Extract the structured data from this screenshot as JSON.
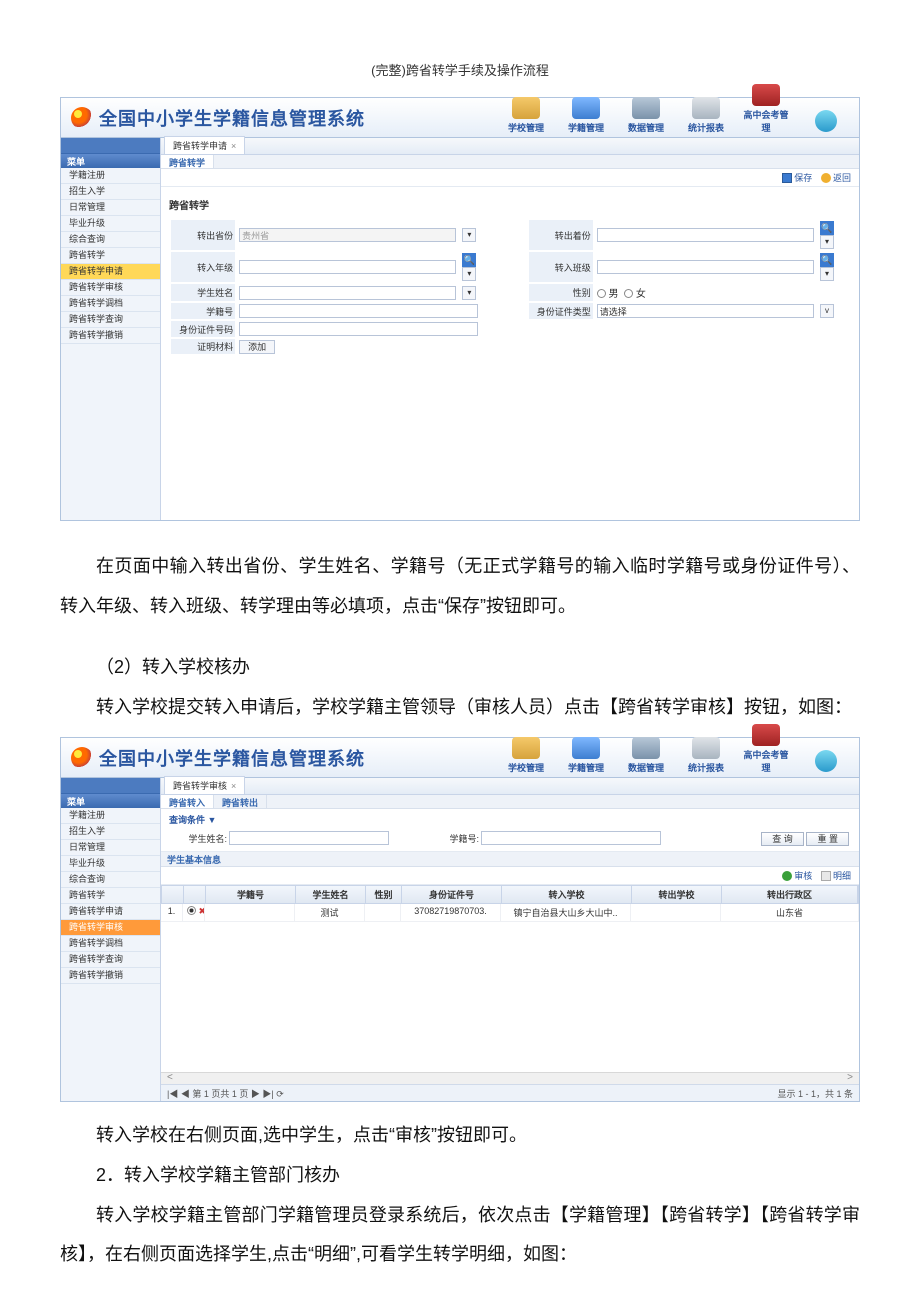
{
  "page_title": "(完整)跨省转学手续及操作流程",
  "system_title": "全国中小学生学籍信息管理系统",
  "topnav": [
    "学校管理",
    "学籍管理",
    "数据管理",
    "统计报表",
    "高中会考管理"
  ],
  "sidebar1": {
    "menu_header": "菜单",
    "items": [
      "学籍注册",
      "招生入学",
      "日常管理",
      "毕业升级",
      "综合查询",
      "跨省转学",
      "跨省转学申请",
      "跨省转学审核",
      "跨省转学调档",
      "跨省转学查询",
      "跨省转学撤销"
    ],
    "selected": "跨省转学申请"
  },
  "screen1": {
    "tab": "跨省转学申请",
    "sub": "跨省转学",
    "toolbar": {
      "save": "保存",
      "back": "返回"
    },
    "section_title": "跨省转学",
    "fields": {
      "out_prov_label": "转出省份",
      "out_prov_value": "贵州省",
      "out_county_label": "转出着份",
      "in_grade_label": "转入年级",
      "in_class_label": "转入班级",
      "name_label": "学生姓名",
      "gender_label": "性别",
      "gender_m": "男",
      "gender_f": "女",
      "sid_label": "学籍号",
      "idtype_label": "身份证件类型",
      "idtype_value": "请选择",
      "idno_label": "身份证件号码",
      "proof_label": "证明材料",
      "add_btn": "添加"
    }
  },
  "para1": "在页面中输入转出省份、学生姓名、学籍号（无正式学籍号的输入临时学籍号或身份证件号）、转入年级、转入班级、转学理由等必填项，点击“保存”按钮即可。",
  "para2": "（2）转入学校核办",
  "para3": "转入学校提交转入申请后，学校学籍主管领导（审核人员）点击【跨省转学审核】按钮，如图：",
  "sidebar2": {
    "menu_header": "菜单",
    "items": [
      "学籍注册",
      "招生入学",
      "日常管理",
      "毕业升级",
      "综合查询",
      "跨省转学",
      "跨省转学申请",
      "跨省转学审核",
      "跨省转学调档",
      "跨省转学查询",
      "跨省转学撤销"
    ],
    "selected": "跨省转学审核"
  },
  "screen2": {
    "tab": "跨省转学审核",
    "sub_in": "跨省转入",
    "sub_out": "跨省转出",
    "filter": {
      "cond": "查询条件 ▼",
      "name_label": "学生姓名:",
      "sid_label": "学籍号:",
      "q": "查 询",
      "r": "重 置"
    },
    "sec_title": "学生基本信息",
    "toolbar": {
      "ok": "审核",
      "det": "明细"
    },
    "headers": [
      "",
      "",
      "学籍号",
      "学生姓名",
      "性别",
      "身份证件号",
      "转入学校",
      "转出学校",
      "转出行政区"
    ],
    "row": {
      "idx": "1.",
      "mark": "✖",
      "sid": "",
      "name": "测试",
      "sex": "",
      "idno": "37082719870703.",
      "in_school": "镇宁自治县大山乡大山中..",
      "out_school": "",
      "out_area": "山东省"
    },
    "pager": {
      "left": "|◀  ◀  第 1   页共 1 页  ▶  ▶|  ⟳",
      "right": "显示 1 - 1，共 1 条"
    }
  },
  "para4": "转入学校在右侧页面,选中学生，点击“审核”按钮即可。",
  "para5": "2．转入学校学籍主管部门核办",
  "para6": "转入学校学籍主管部门学籍管理员登录系统后，依次点击【学籍管理】【跨省转学】【跨省转学审核】，在右侧页面选择学生,点击“明细”,可看学生转学明细，如图："
}
